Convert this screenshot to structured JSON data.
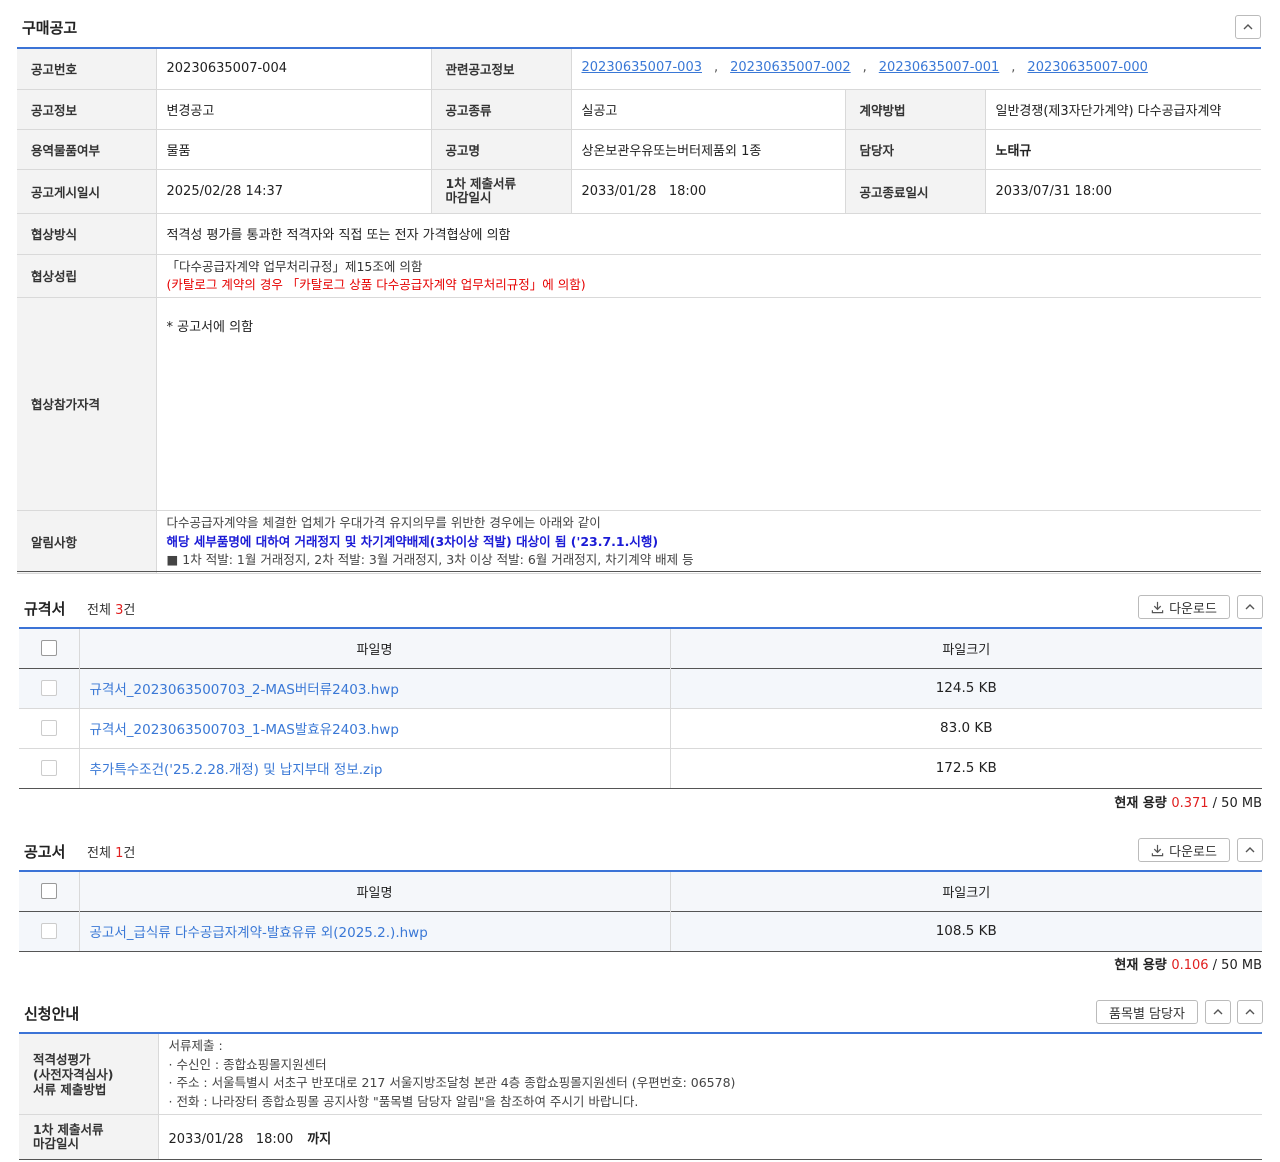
{
  "purchase": {
    "title": "구매공고",
    "rows": {
      "notice_no_label": "공고번호",
      "notice_no": "20230635007-004",
      "related_label": "관련공고정보",
      "related": [
        "20230635007-003",
        "20230635007-002",
        "20230635007-001",
        "20230635007-000"
      ],
      "related_sep": ",",
      "info_label": "공고정보",
      "info": "변경공고",
      "kind_label": "공고종류",
      "kind": "실공고",
      "contract_label": "계약방법",
      "contract": "일반경쟁(제3자단가계약) 다수공급자계약",
      "service_label": "용역물품여부",
      "service": "물품",
      "name_label": "공고명",
      "name": "상온보관우유또는버터제품외 1종",
      "manager_label": "담당자",
      "manager": "노태규",
      "posted_label": "공고게시일시",
      "posted": "2025/02/28 14:37",
      "deadline_label_1": "1차 제출서류",
      "deadline_label_2": "마감일시",
      "deadline": "2033/01/28   18:00",
      "end_label": "공고종료일시",
      "end": "2033/07/31 18:00",
      "method_label": "협상방식",
      "method": "적격성 평가를 통과한 적격자와 직접 또는 전자 가격협상에 의함",
      "agree_label": "협상성립",
      "agree_1": "「다수공급자계약 업무처리규정」제15조에 의함",
      "agree_2": "(카탈로그 계약의 경우 「카탈로그 상품 다수공급자계약 업무처리규정」에 의함)",
      "qual_label": "협상참가자격",
      "qual": "* 공고서에 의함",
      "notice_label": "알림사항",
      "notice_1": "다수공급자계약을 체결한 업체가 우대가격 유지의무를 위반한 경우에는 아래와 같이",
      "notice_2": "해당 세부품명에 대하여 거래정지 및 차기계약배제(3차이상 적발) 대상이 됨 ('23.7.1.시행)",
      "notice_3": "■ 1차 적발: 1월 거래정지, 2차 적발: 3월 거래정지, 3차 이상 적발: 6월 거래정지, 차기계약 배제 등"
    }
  },
  "spec": {
    "title": "규격서",
    "count_prefix": "전체 ",
    "count": "3",
    "count_suffix": "건",
    "download": "다운로드",
    "col_name": "파일명",
    "col_size": "파일크기",
    "files": [
      {
        "name": "규격서_2023063500703_2-MAS버터류2403.hwp",
        "size": "124.5 KB"
      },
      {
        "name": "규격서_2023063500703_1-MAS발효유2403.hwp",
        "size": "83.0 KB"
      },
      {
        "name": "추가특수조건('25.2.28.개정) 및 납지부대 정보.zip",
        "size": "172.5 KB"
      }
    ],
    "cap_label": "현재 용량 ",
    "cap_current": "0.371",
    "cap_total": " / 50 MB"
  },
  "notice_doc": {
    "title": "공고서",
    "count_prefix": "전체 ",
    "count": "1",
    "count_suffix": "건",
    "download": "다운로드",
    "col_name": "파일명",
    "col_size": "파일크기",
    "files": [
      {
        "name": "공고서_급식류 다수공급자계약-발효유류 외(2025.2.).hwp",
        "size": "108.5 KB"
      }
    ],
    "cap_label": "현재 용량 ",
    "cap_current": "0.106",
    "cap_total": " / 50 MB"
  },
  "apply": {
    "title": "신청안내",
    "item_manager_btn": "품목별 담당자",
    "method_label_1": "적격성평가",
    "method_label_2": "(사전자격심사)",
    "method_label_3": "서류 제출방법",
    "method_1": "서류제출 :",
    "method_2": "· 수신인 : 종합쇼핑몰지원센터",
    "method_3": "· 주소 : 서울특별시 서초구 반포대로 217 서울지방조달청 본관 4층 종합쇼핑몰지원센터 (우편번호: 06578)",
    "method_4": "· 전화 : 나라장터 종합쇼핑몰 공지사항 \"품목별 담당자 알림\"을 참조하여 주시기 바랍니다.",
    "deadline_label_1": "1차 제출서류",
    "deadline_label_2": "마감일시",
    "deadline": "2033/01/28   18:00",
    "deadline_suffix": "까지"
  },
  "colors": {
    "accent_line": "#3b73d6",
    "link": "#3a78d6",
    "red": "#e02020",
    "blue": "#1b1bd6"
  },
  "icons": [
    "chevron-up-icon",
    "download-icon"
  ]
}
